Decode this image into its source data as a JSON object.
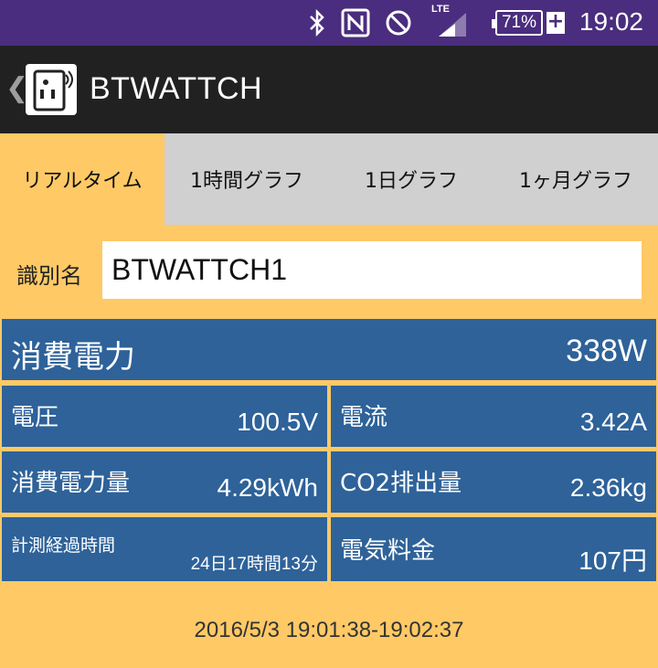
{
  "status_bar": {
    "time": "19:02",
    "battery_level": "71%",
    "network_type": "LTE",
    "icons": [
      "bluetooth-icon",
      "nfc-icon",
      "do-not-disturb-icon",
      "signal-icon",
      "battery-icon",
      "charging-icon"
    ]
  },
  "action_bar": {
    "title": "BTWATTCH",
    "back_icon": "chevron-left-icon",
    "app_icon": "smart-plug-icon"
  },
  "tabs": [
    {
      "label": "リアルタイム",
      "active": true
    },
    {
      "label": "1時間グラフ",
      "active": false
    },
    {
      "label": "1日グラフ",
      "active": false
    },
    {
      "label": "1ヶ月グラフ",
      "active": false
    }
  ],
  "device": {
    "name_label": "識別名",
    "name_value": "BTWATTCH1"
  },
  "metrics": {
    "power": {
      "label": "消費電力",
      "value": "338W"
    },
    "voltage": {
      "label": "電圧",
      "value": "100.5V"
    },
    "current": {
      "label": "電流",
      "value": "3.42A"
    },
    "energy": {
      "label": "消費電力量",
      "value": "4.29kWh"
    },
    "co2": {
      "label": "CO2排出量",
      "value": "2.36kg"
    },
    "elapsed": {
      "label": "計測経過時間",
      "value": "24日17時間13分"
    },
    "cost": {
      "label": "電気料金",
      "value": "107円"
    }
  },
  "time_range": "2016/5/3 19:01:38-19:02:37",
  "colors": {
    "status_bar": "#4a2d7e",
    "action_bar": "#212121",
    "background": "#ffc966",
    "inactive_tab": "#d0d0d0",
    "cell": "#2e6299"
  }
}
